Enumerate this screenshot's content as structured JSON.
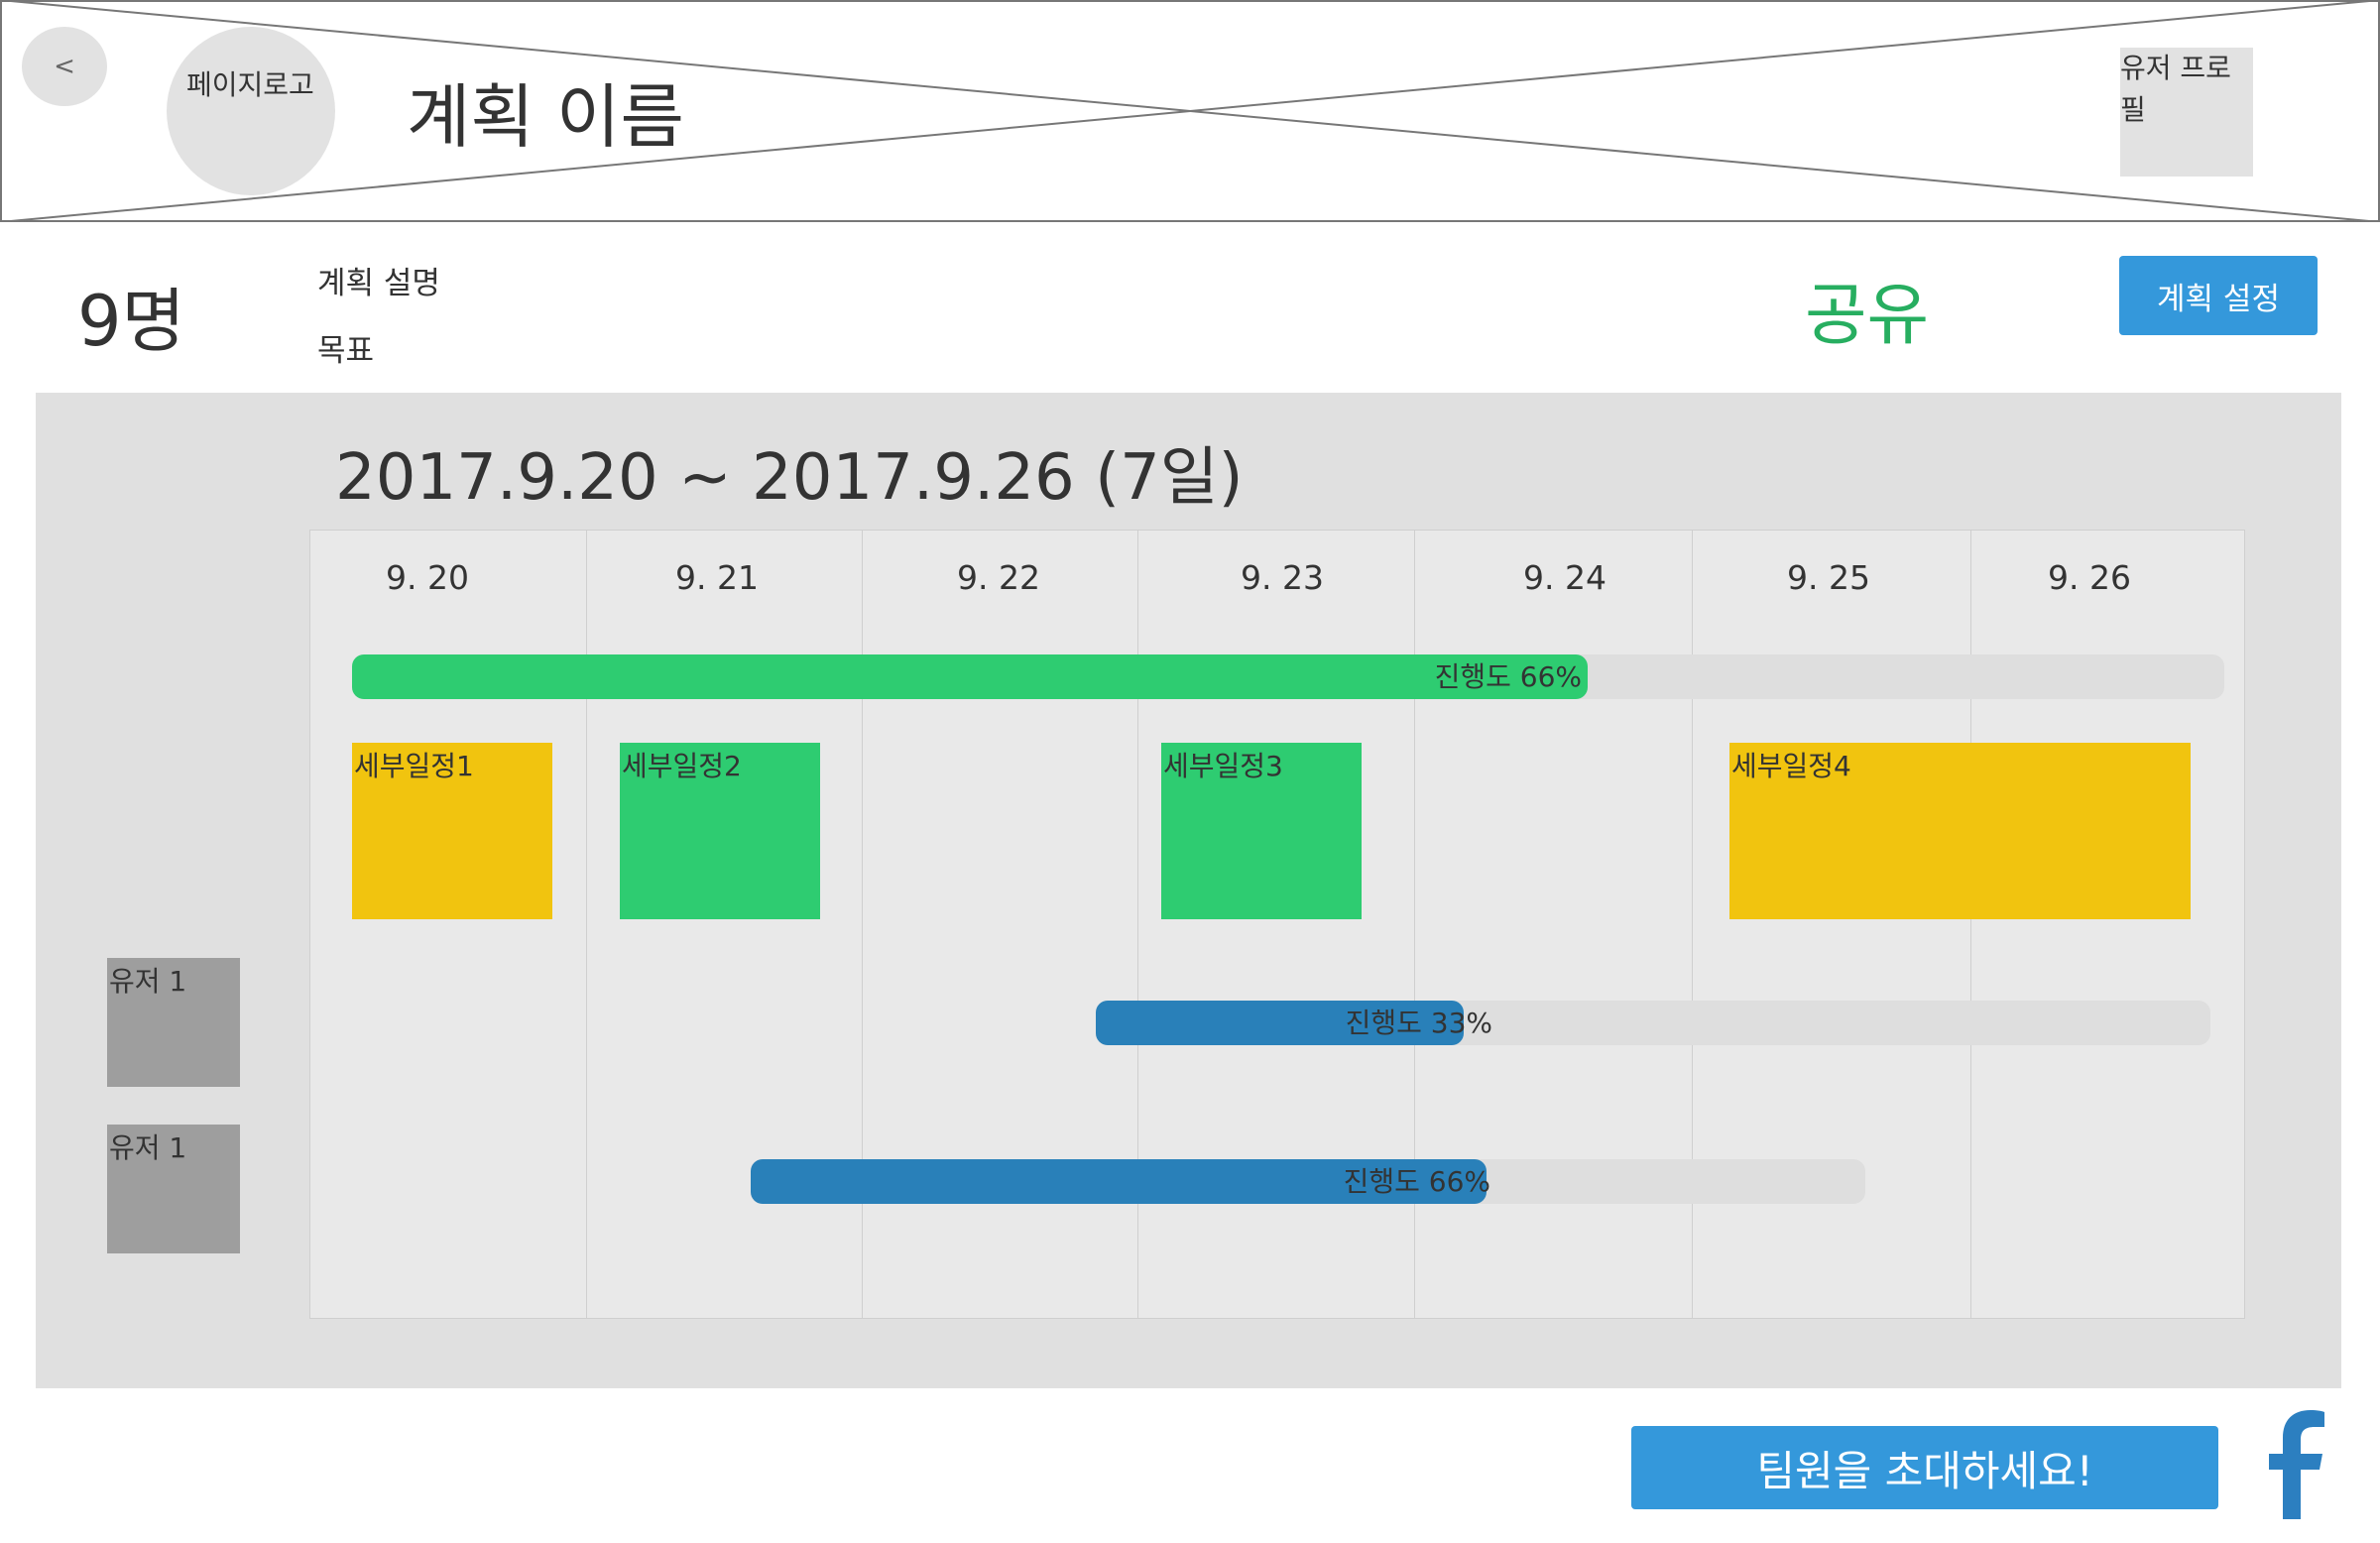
{
  "header": {
    "back_label": "<",
    "logo_label": "페이지로고",
    "plan_title": "계획 이름",
    "profile_label": "유저 프로필"
  },
  "info": {
    "member_count": "9명",
    "plan_description": "계획 설명",
    "goal": "목표",
    "share_label": "공유",
    "settings_label": "계획 설정"
  },
  "schedule": {
    "date_range": "2017.9.20 ~ 2017.9.26 (7일)",
    "days": [
      "9. 20",
      "9. 21",
      "9. 22",
      "9. 23",
      "9. 24",
      "9. 25",
      "9. 26"
    ],
    "overall_progress": {
      "label": "진행도 66%",
      "percent": 66
    },
    "subtasks": [
      {
        "label": "세부일정1",
        "color": "#f1c40f"
      },
      {
        "label": "세부일정2",
        "color": "#2ecc71"
      },
      {
        "label": "세부일정3",
        "color": "#2ecc71"
      },
      {
        "label": "세부일정4",
        "color": "#f1c40f"
      }
    ],
    "users": [
      {
        "label": "유저 1",
        "progress_label": "진행도 33%",
        "percent": 33
      },
      {
        "label": "유저 1",
        "progress_label": "진행도 66%",
        "percent": 66
      }
    ]
  },
  "footer": {
    "invite_label": "팀원을 초대하세요!",
    "facebook_icon": "facebook-icon"
  },
  "colors": {
    "primary_blue": "#3498db",
    "progress_green": "#2ecc71",
    "progress_blue": "#2980b9",
    "share_green": "#27ae60",
    "subtask_yellow": "#f1c40f"
  }
}
